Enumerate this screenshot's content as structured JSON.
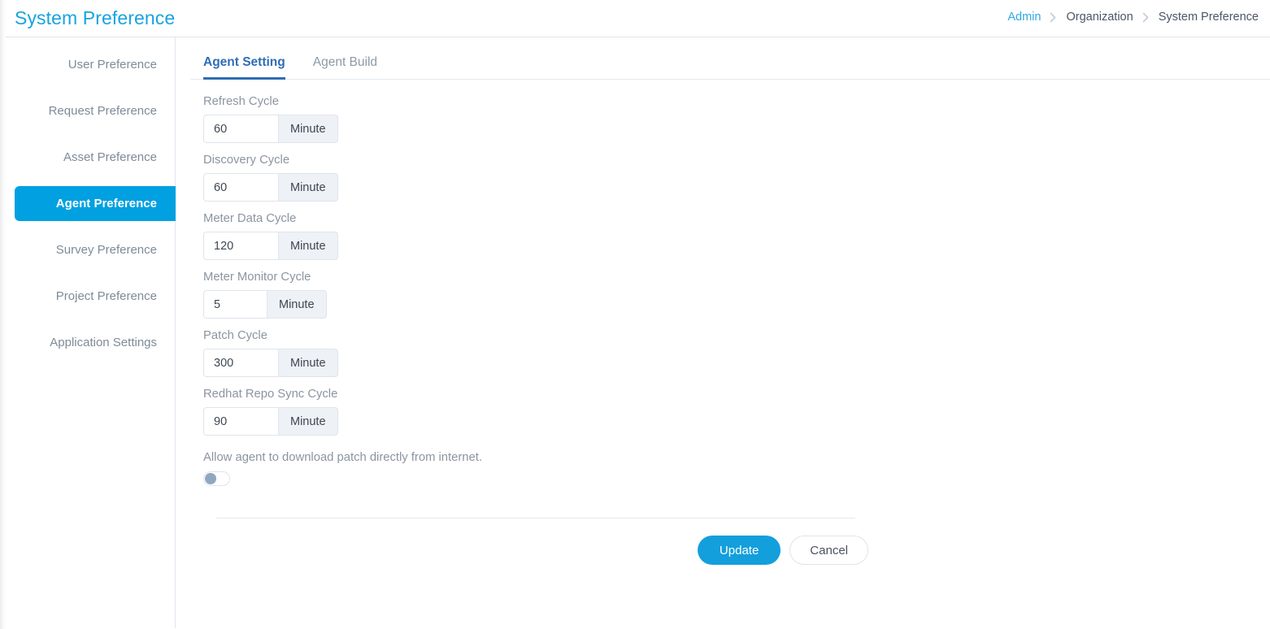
{
  "header": {
    "title": "System Preference",
    "breadcrumb": [
      {
        "label": "Admin",
        "type": "link"
      },
      {
        "label": "Organization",
        "type": "static"
      },
      {
        "label": "System Preference",
        "type": "static"
      }
    ]
  },
  "sidebar": {
    "items": [
      {
        "label": "User Preference",
        "active": false
      },
      {
        "label": "Request Preference",
        "active": false
      },
      {
        "label": "Asset Preference",
        "active": false
      },
      {
        "label": "Agent Preference",
        "active": true
      },
      {
        "label": "Survey Preference",
        "active": false
      },
      {
        "label": "Project Preference",
        "active": false
      },
      {
        "label": "Application Settings",
        "active": false
      }
    ]
  },
  "main": {
    "tabs": [
      {
        "label": "Agent Setting",
        "active": true
      },
      {
        "label": "Agent Build",
        "active": false
      }
    ],
    "fields": [
      {
        "label": "Refresh Cycle",
        "value": "60",
        "unit": "Minute",
        "width": "wide"
      },
      {
        "label": "Discovery Cycle",
        "value": "60",
        "unit": "Minute",
        "width": "wide"
      },
      {
        "label": "Meter Data Cycle",
        "value": "120",
        "unit": "Minute",
        "width": "wide"
      },
      {
        "label": "Meter Monitor Cycle",
        "value": "5",
        "unit": "Minute",
        "width": "narrow"
      },
      {
        "label": "Patch Cycle",
        "value": "300",
        "unit": "Minute",
        "width": "wide"
      },
      {
        "label": "Redhat Repo Sync Cycle",
        "value": "90",
        "unit": "Minute",
        "width": "wide"
      }
    ],
    "toggle": {
      "label": "Allow agent to download patch directly from internet.",
      "state": "off"
    },
    "actions": {
      "update_label": "Update",
      "cancel_label": "Cancel"
    }
  },
  "colors": {
    "brand_blue": "#18a3e0",
    "active_sidebar": "#00a0e1",
    "tab_active": "#2f6db5",
    "primary_button": "#139fdc",
    "label_gray": "#8b95a1"
  }
}
